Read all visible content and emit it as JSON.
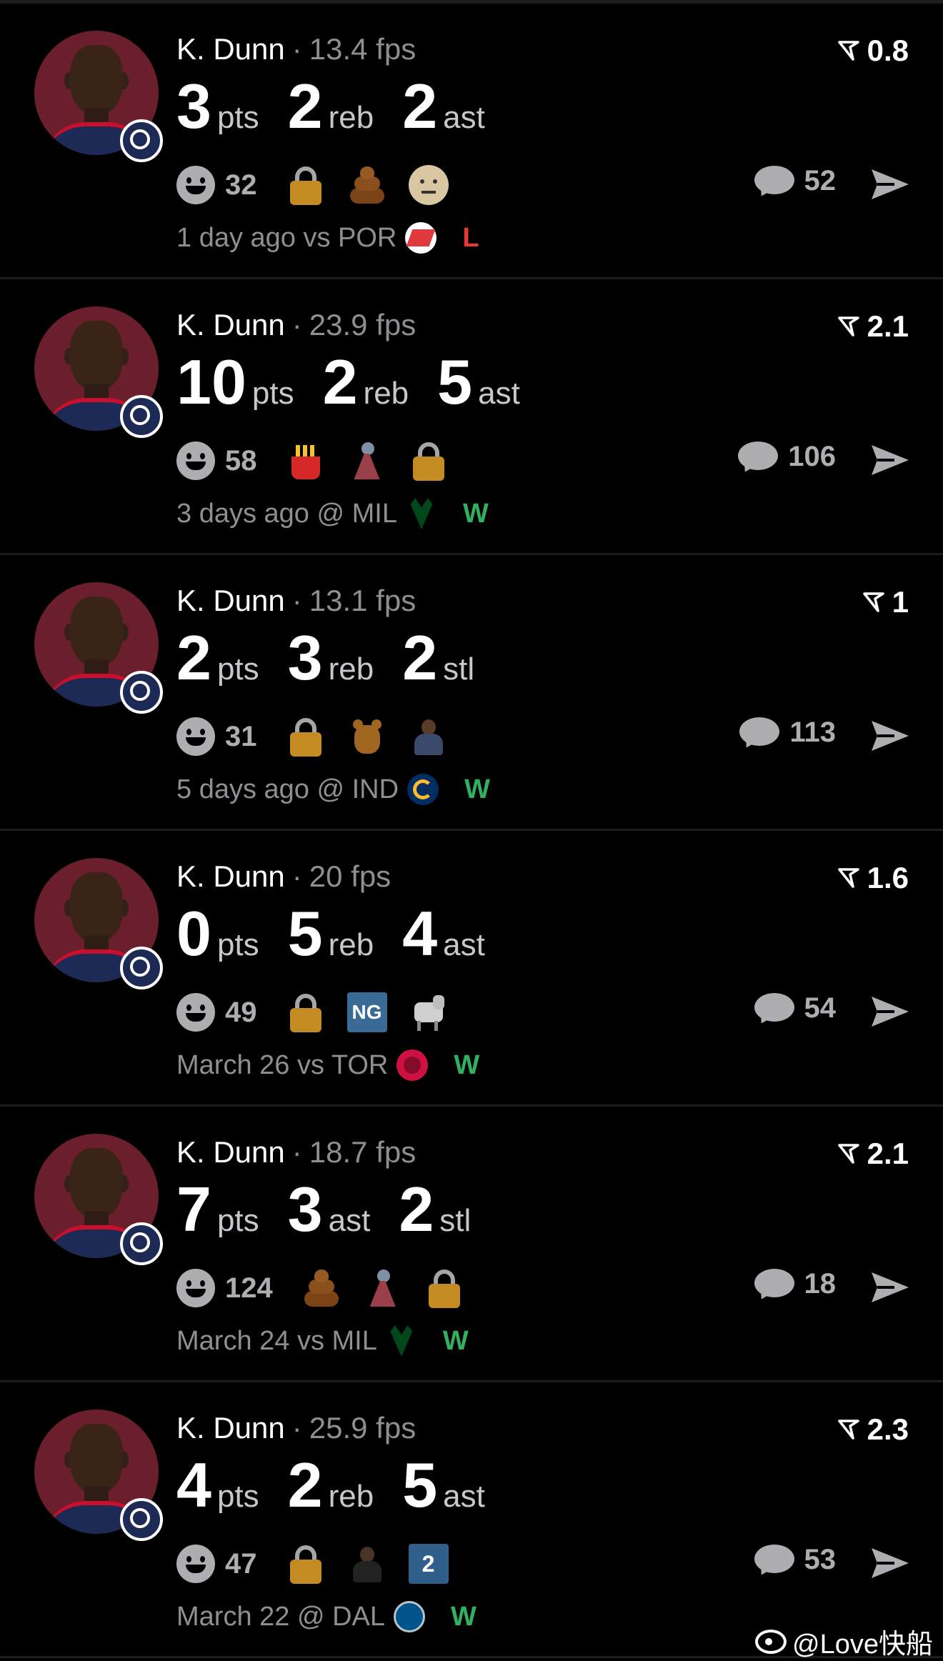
{
  "cards": [
    {
      "player": "K. Dunn",
      "fps": "13.4 fps",
      "score": "0.8",
      "stats": [
        {
          "num": "3",
          "label": "pts"
        },
        {
          "num": "2",
          "label": "reb"
        },
        {
          "num": "2",
          "label": "ast"
        }
      ],
      "reaction_count": "32",
      "emojis": [
        "lock",
        "poo",
        "face-neutral"
      ],
      "comments": "52",
      "when": "1 day ago vs POR",
      "team_logo": "por-logo",
      "result": "L"
    },
    {
      "player": "K. Dunn",
      "fps": "23.9 fps",
      "score": "2.1",
      "stats": [
        {
          "num": "10",
          "label": "pts"
        },
        {
          "num": "2",
          "label": "reb"
        },
        {
          "num": "5",
          "label": "ast"
        }
      ],
      "reaction_count": "58",
      "emojis": [
        "fries",
        "vase",
        "lock"
      ],
      "comments": "106",
      "when": "3 days ago @ MIL",
      "team_logo": "mil-logo",
      "result": "W"
    },
    {
      "player": "K. Dunn",
      "fps": "13.1 fps",
      "score": "1",
      "stats": [
        {
          "num": "2",
          "label": "pts"
        },
        {
          "num": "3",
          "label": "reb"
        },
        {
          "num": "2",
          "label": "stl"
        }
      ],
      "reaction_count": "31",
      "emojis": [
        "lock",
        "bear",
        "person"
      ],
      "comments": "113",
      "when": "5 days ago @ IND",
      "team_logo": "ind-logo",
      "result": "W"
    },
    {
      "player": "K. Dunn",
      "fps": "20 fps",
      "score": "1.6",
      "stats": [
        {
          "num": "0",
          "label": "pts"
        },
        {
          "num": "5",
          "label": "reb"
        },
        {
          "num": "4",
          "label": "ast"
        }
      ],
      "reaction_count": "49",
      "emojis": [
        "lock",
        "ng",
        "goat"
      ],
      "comments": "54",
      "when": "March 26 vs TOR",
      "team_logo": "tor-logo",
      "result": "W"
    },
    {
      "player": "K. Dunn",
      "fps": "18.7 fps",
      "score": "2.1",
      "stats": [
        {
          "num": "7",
          "label": "pts"
        },
        {
          "num": "3",
          "label": "ast"
        },
        {
          "num": "2",
          "label": "stl"
        }
      ],
      "reaction_count": "124",
      "emojis": [
        "poo",
        "vase",
        "lock"
      ],
      "comments": "18",
      "when": "March 24 vs MIL",
      "team_logo": "mil-logo",
      "result": "W"
    },
    {
      "player": "K. Dunn",
      "fps": "25.9 fps",
      "score": "2.3",
      "stats": [
        {
          "num": "4",
          "label": "pts"
        },
        {
          "num": "2",
          "label": "reb"
        },
        {
          "num": "5",
          "label": "ast"
        }
      ],
      "reaction_count": "47",
      "emojis": [
        "lock",
        "person2",
        "two"
      ],
      "comments": "53",
      "when": "March 22 @ DAL",
      "team_logo": "dal-logo",
      "result": "W"
    }
  ],
  "emoji_text": {
    "ng": "NG",
    "two": "2"
  },
  "watermark": "@Love快船",
  "colors": {
    "win": "#30b060",
    "loss": "#e53935",
    "background": "#000000",
    "muted": "#8e8e93"
  }
}
